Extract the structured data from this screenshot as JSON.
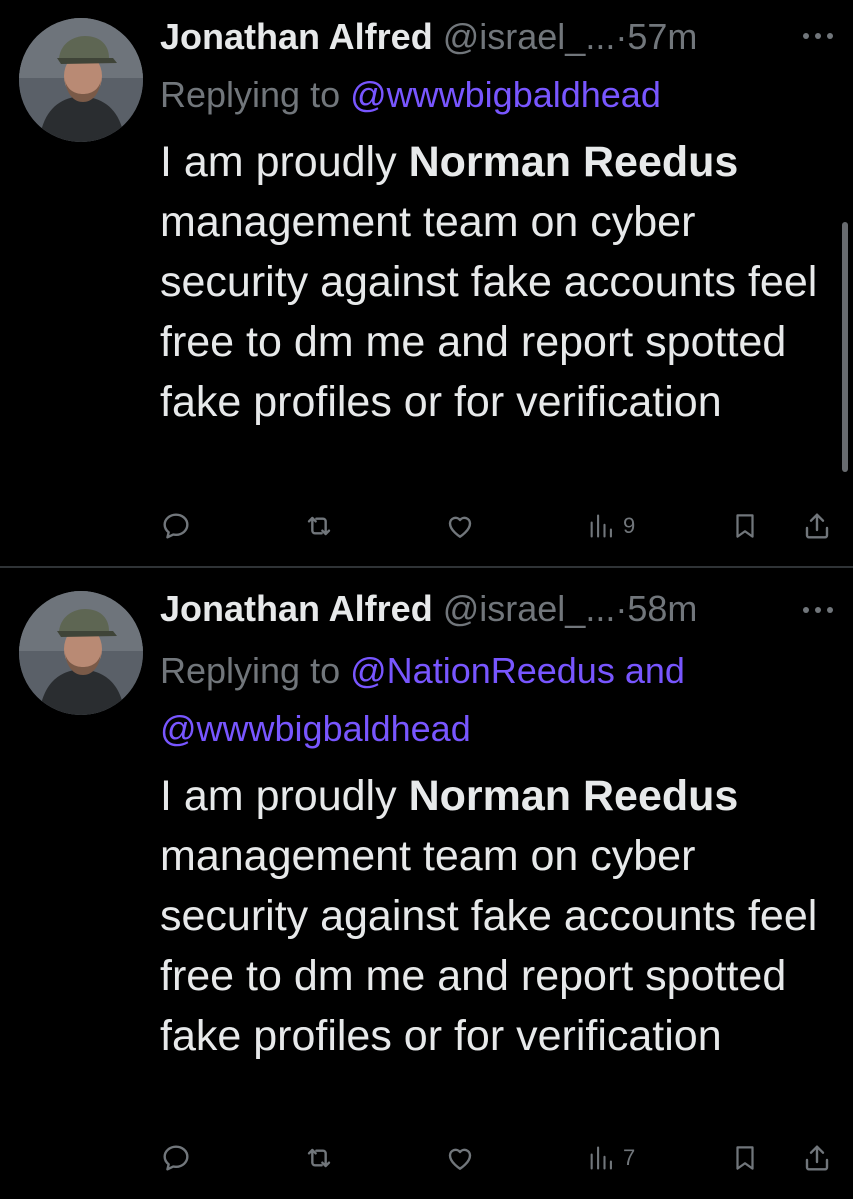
{
  "tweets": [
    {
      "author": {
        "display_name": "Jonathan Alfred",
        "handle": "@israel_...",
        "avatar_icon": "avatar-photo"
      },
      "separator": "·",
      "time": "57m",
      "replying_prefix": "Replying to",
      "mentions": [
        "@wwwbigbaldhead"
      ],
      "mention_joiner": "",
      "text": {
        "prefix": "I am proudly ",
        "bold": "Norman Reedus",
        "suffix": " management team on cyber security against fake accounts feel free to dm me and report spotted fake profiles or for verification"
      },
      "views": "9"
    },
    {
      "author": {
        "display_name": "Jonathan Alfred",
        "handle": "@israel_...",
        "avatar_icon": "avatar-photo"
      },
      "separator": "·",
      "time": "58m",
      "replying_prefix": "Replying to",
      "mentions": [
        "@NationReedus",
        "@wwwbigbaldhead"
      ],
      "mention_joiner": "and",
      "text": {
        "prefix": "I am proudly ",
        "bold": "Norman Reedus",
        "suffix": " management team on cyber security against fake accounts feel free to dm me and report spotted fake profiles or for verification"
      },
      "views": "7"
    }
  ],
  "icons": {
    "reply": "reply-icon",
    "retweet": "retweet-icon",
    "like": "like-icon",
    "views": "views-icon",
    "bookmark": "bookmark-icon",
    "share": "share-icon",
    "more": "more-icon"
  },
  "colors": {
    "background": "#000000",
    "text_primary": "#e7e9ea",
    "text_secondary": "#71767b",
    "mention": "#7856ff",
    "divider": "#2f3336"
  }
}
